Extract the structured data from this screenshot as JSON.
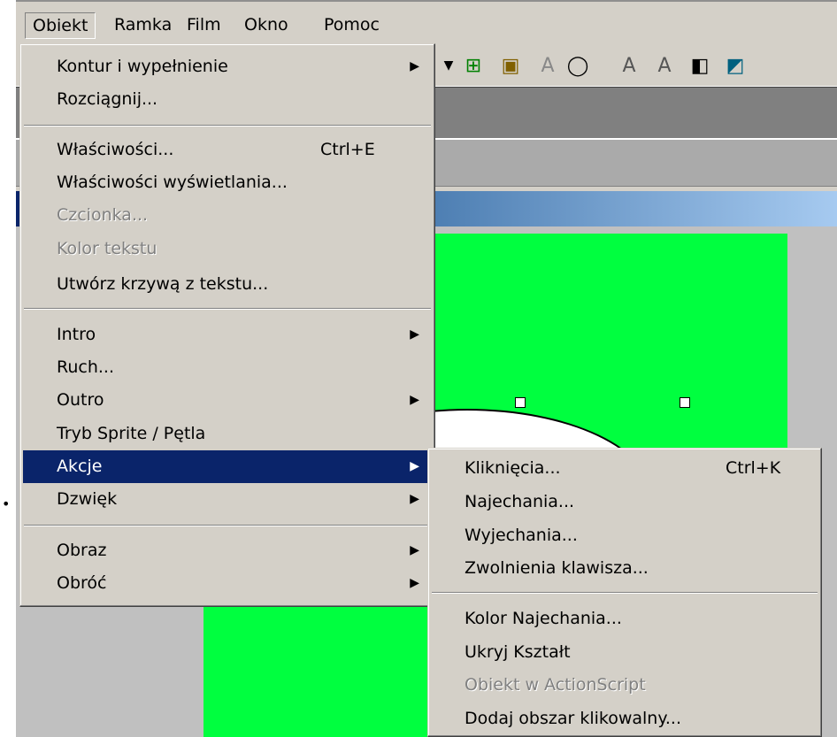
{
  "menubar": [
    "Obiekt",
    "Ramka",
    "Film",
    "Okno",
    "Pomoc"
  ],
  "obiekt_menu": {
    "group1": [
      "Kontur i wypełnienie",
      "Rozciągnij..."
    ],
    "group2": [
      {
        "label": "Właściwości...",
        "shortcut": "Ctrl+E"
      },
      {
        "label": "Właściwości wyświetlania..."
      },
      {
        "label": "Czcionka...",
        "disabled": true
      },
      {
        "label": "Kolor tekstu",
        "disabled": true
      },
      {
        "label": "Utwórz krzywą z tekstu..."
      }
    ],
    "group3": [
      "Intro",
      "Ruch...",
      "Outro",
      "Tryb Sprite / Pętla",
      "Akcje",
      "Dzwięk"
    ],
    "group4": [
      "Obraz",
      "Obróć"
    ]
  },
  "akcje_menu": {
    "group1": [
      {
        "label": "Kliknięcia...",
        "shortcut": "Ctrl+K"
      },
      {
        "label": "Najechania..."
      },
      {
        "label": "Wyjechania..."
      },
      {
        "label": "Zwolnienia klawisza..."
      }
    ],
    "group2": [
      {
        "label": "Kolor Najechania..."
      },
      {
        "label": "Ukryj Kształt"
      },
      {
        "label": "Obiekt w ActionScript",
        "disabled": true
      },
      {
        "label": "Dodaj obszar klikowalny..."
      }
    ]
  },
  "toolbar_icons": [
    "dropdown-arrow",
    "align-grid-icon",
    "properties-icon",
    "text-icon",
    "speech-bubble-icon",
    "text-grow-icon",
    "text-shrink-icon",
    "gradient-icon",
    "fill-icon"
  ],
  "colors": {
    "canvas": "#00ff3f",
    "highlight": "#0a246a",
    "face": "#d4d0c8"
  }
}
